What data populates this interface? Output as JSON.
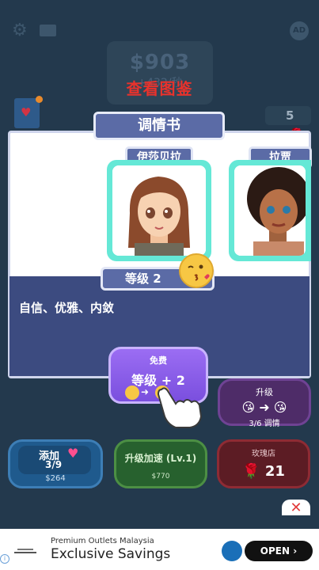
{
  "header": {
    "money": "$903",
    "per_second": "+432/秒",
    "gallery_label": "查看图鉴",
    "ad_badge": "AD",
    "roses": "5"
  },
  "panel": {
    "title": "调情书",
    "characters": [
      {
        "name": "伊莎贝拉"
      },
      {
        "name": "拉贾"
      }
    ],
    "level": "等级 2",
    "traits": "自信、优雅、内敛"
  },
  "free_button": {
    "label": "免费",
    "action": "等级 + 2"
  },
  "bottom": {
    "add_label": "添加",
    "add_progress": "3/9",
    "add_cost": "$264",
    "speed_label": "升级加速 (Lv.1)",
    "speed_cost": "$770",
    "store_label": "玫瑰店",
    "store_roses": "21",
    "upgrade_label": "升级",
    "upgrade_progress": "3/6 调情"
  },
  "ad": {
    "small_text": "Premium Outlets Malaysia",
    "big_text": "Exclusive Savings",
    "button": "OPEN"
  },
  "colors": {
    "panel_header": "#5b6ba6",
    "card_border": "#65e8d6",
    "gallery_red": "#e8322c",
    "free_button": "#8a5bec"
  }
}
